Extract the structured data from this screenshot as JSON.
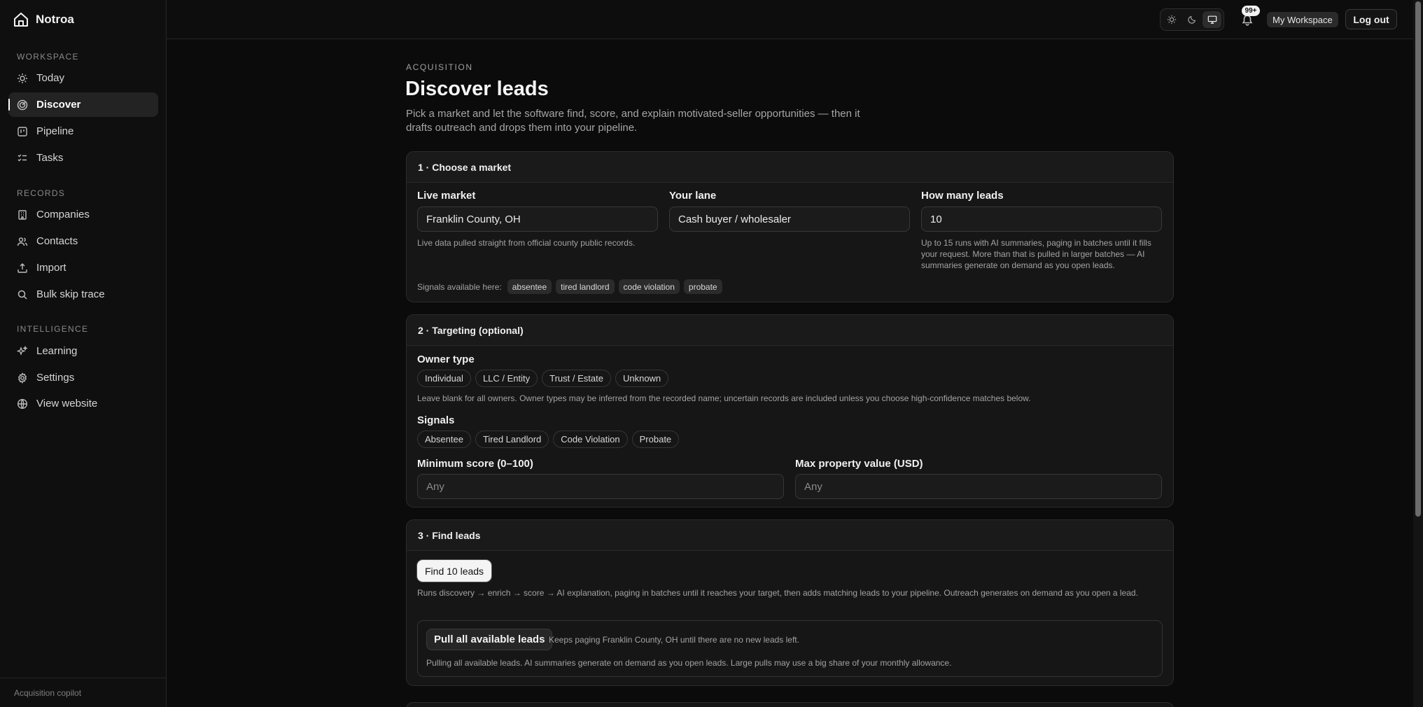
{
  "app": {
    "name": "Notroa",
    "footer": "Acquisition copilot"
  },
  "sidebar": {
    "sections": [
      {
        "label": "WORKSPACE",
        "items": [
          {
            "label": "Today",
            "icon": "sun-icon"
          },
          {
            "label": "Discover",
            "icon": "radar-icon",
            "active": true
          },
          {
            "label": "Pipeline",
            "icon": "kanban-icon"
          },
          {
            "label": "Tasks",
            "icon": "checklist-icon"
          }
        ]
      },
      {
        "label": "RECORDS",
        "items": [
          {
            "label": "Companies",
            "icon": "building-icon"
          },
          {
            "label": "Contacts",
            "icon": "users-icon"
          },
          {
            "label": "Import",
            "icon": "upload-icon"
          },
          {
            "label": "Bulk skip trace",
            "icon": "search-icon"
          }
        ]
      },
      {
        "label": "INTELLIGENCE",
        "items": [
          {
            "label": "Learning",
            "icon": "sparkles-icon"
          },
          {
            "label": "Settings",
            "icon": "gear-icon"
          },
          {
            "label": "View website",
            "icon": "globe-icon"
          }
        ]
      }
    ]
  },
  "topbar": {
    "theme_options": [
      "light",
      "dark",
      "system"
    ],
    "theme_selected": "system",
    "notifications_badge": "99+",
    "workspace": "My Workspace",
    "logout": "Log out"
  },
  "page": {
    "eyebrow": "ACQUISITION",
    "title": "Discover leads",
    "description": "Pick a market and let the software find, score, and explain motivated-seller opportunities — then it drafts outreach and drops them into your pipeline."
  },
  "step1": {
    "title": "1 · Choose a market",
    "market_label": "Live market",
    "market_value": "Franklin County, OH",
    "market_hint": "Live data pulled straight from official county public records.",
    "lane_label": "Your lane",
    "lane_value": "Cash buyer / wholesaler",
    "count_label": "How many leads",
    "count_value": "10",
    "count_hint": "Up to 15 runs with AI summaries, paging in batches until it fills your request. More than that is pulled in larger batches — AI summaries generate on demand as you open leads.",
    "signals_label": "Signals available here:",
    "signals": [
      "absentee",
      "tired landlord",
      "code violation",
      "probate"
    ]
  },
  "step2": {
    "title": "2 · Targeting (optional)",
    "owner_label": "Owner type",
    "owner_types": [
      "Individual",
      "LLC / Entity",
      "Trust / Estate",
      "Unknown"
    ],
    "owner_hint": "Leave blank for all owners. Owner types may be inferred from the recorded name; uncertain records are included unless you choose high-confidence matches below.",
    "signals_label": "Signals",
    "signals": [
      "Absentee",
      "Tired Landlord",
      "Code Violation",
      "Probate"
    ],
    "min_score_label": "Minimum score (0–100)",
    "min_score_placeholder": "Any",
    "max_value_label": "Max property value (USD)",
    "max_value_placeholder": "Any"
  },
  "step3": {
    "title": "3 · Find leads",
    "find_button": "Find 10 leads",
    "find_hint": "Runs discovery → enrich → score → AI explanation, paging in batches until it reaches your target, then adds matching leads to your pipeline. Outreach generates on demand as you open a lead.",
    "pull_button": "Pull all available leads",
    "pull_inline_hint": "Keeps paging Franklin County, OH until there are no new leads left.",
    "pull_hint": "Pulling all available leads. AI summaries generate on demand as you open leads. Large pulls may use a big share of your monthly allowance."
  }
}
